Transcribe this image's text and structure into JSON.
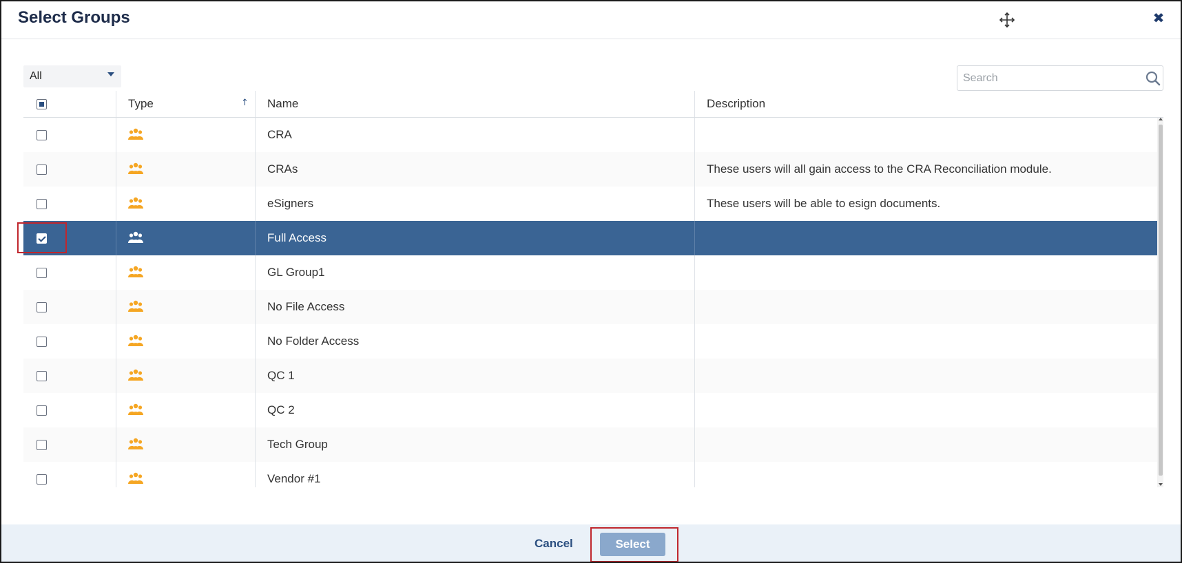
{
  "dialog": {
    "title": "Select Groups",
    "close_label": "✖"
  },
  "filter": {
    "selected": "All"
  },
  "search": {
    "placeholder": "Search"
  },
  "columns": {
    "type": "Type",
    "name": "Name",
    "description": "Description",
    "sort_indicator": "↑"
  },
  "rows": [
    {
      "name": "CRA",
      "description": "",
      "checked": false
    },
    {
      "name": "CRAs",
      "description": "These users will all gain access to the CRA Reconciliation module.",
      "checked": false
    },
    {
      "name": "eSigners",
      "description": "These users will be able to esign documents.",
      "checked": false
    },
    {
      "name": "Full Access",
      "description": "",
      "checked": true
    },
    {
      "name": "GL Group1",
      "description": "",
      "checked": false
    },
    {
      "name": "No File Access",
      "description": "",
      "checked": false
    },
    {
      "name": "No Folder Access",
      "description": "",
      "checked": false
    },
    {
      "name": "QC 1",
      "description": "",
      "checked": false
    },
    {
      "name": "QC 2",
      "description": "",
      "checked": false
    },
    {
      "name": "Tech Group",
      "description": "",
      "checked": false
    },
    {
      "name": "Vendor #1",
      "description": "",
      "checked": false
    }
  ],
  "footer": {
    "cancel_label": "Cancel",
    "select_label": "Select"
  },
  "colors": {
    "selected_row": "#3a6494",
    "group_icon": "#f5a623",
    "highlight": "#c0262d",
    "select_button": "#8aa8cc"
  },
  "icons": {
    "row_type": "group-icon",
    "search": "search-icon",
    "move": "move-icon",
    "close": "close-icon"
  }
}
